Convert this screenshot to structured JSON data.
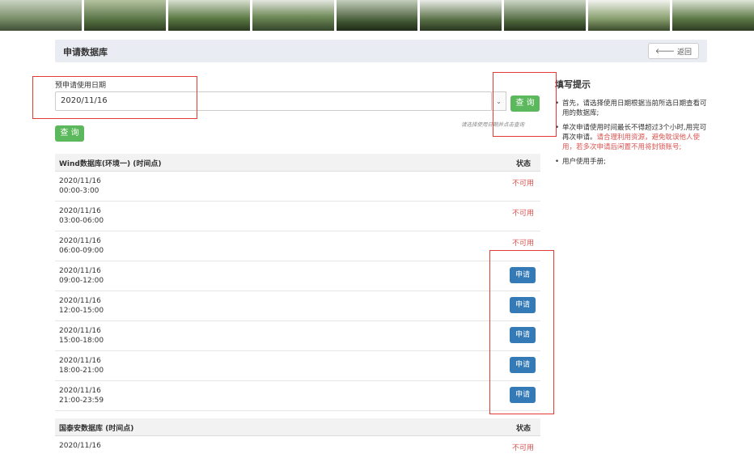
{
  "header": {
    "title": "申请数据库",
    "back_label": "返回"
  },
  "form": {
    "date_label": "预申请使用日期",
    "date_value": "2020/11/16",
    "query_label": "查 询",
    "hint": "请选择使用日期并点击查询",
    "query_main_label": "查 询"
  },
  "tables": [
    {
      "name": "Wind数据库(环境一) (时间点)",
      "status_header": "状态",
      "rows": [
        {
          "date": "2020/11/16",
          "time": "00:00-3:00",
          "status": "不可用"
        },
        {
          "date": "2020/11/16",
          "time": "03:00-06:00",
          "status": "不可用"
        },
        {
          "date": "2020/11/16",
          "time": "06:00-09:00",
          "status": "不可用"
        },
        {
          "date": "2020/11/16",
          "time": "09:00-12:00",
          "status": "申请"
        },
        {
          "date": "2020/11/16",
          "time": "12:00-15:00",
          "status": "申请"
        },
        {
          "date": "2020/11/16",
          "time": "15:00-18:00",
          "status": "申请"
        },
        {
          "date": "2020/11/16",
          "time": "18:00-21:00",
          "status": "申请"
        },
        {
          "date": "2020/11/16",
          "time": "21:00-23:59",
          "status": "申请"
        }
      ]
    },
    {
      "name": "国泰安数据库 (时间点)",
      "status_header": "状态",
      "rows": [
        {
          "date": "2020/11/16",
          "time": "",
          "status": "不可用"
        }
      ]
    }
  ],
  "tips": {
    "title": "填写提示",
    "items": [
      {
        "text": "首先，请选择使用日期根据当前所选日期查看可用的数据库;",
        "red": ""
      },
      {
        "text": "单次申请使用时间最长不得超过3个小时,用完可再次申请。",
        "red": "请合理利用资源，避免耽误他人使用，若多次申请后闲置不用将封锁账号;"
      },
      {
        "text": "用户使用手册;",
        "red": ""
      }
    ]
  },
  "colors": {
    "green": "#5cb85c",
    "blue": "#337ab7",
    "red": "#d9534f",
    "annotation": "#e53935"
  }
}
